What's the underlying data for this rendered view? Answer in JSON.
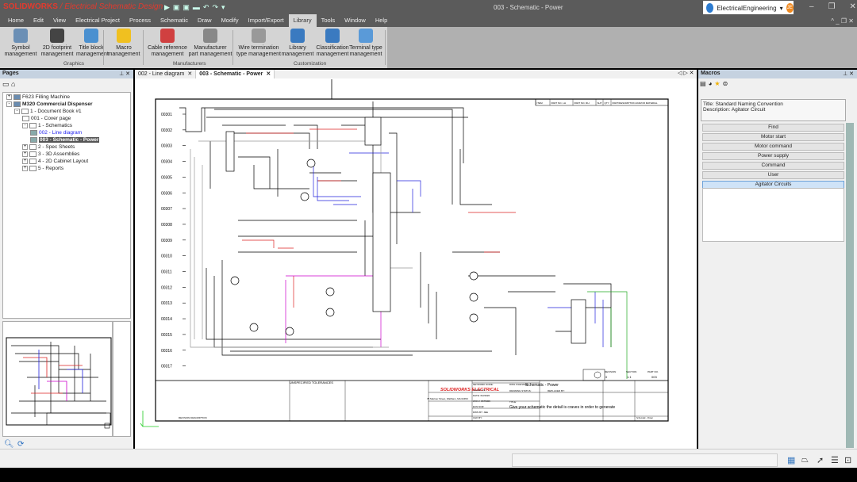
{
  "app": {
    "brand": "SOLIDWORKS",
    "product": "Electrical Schematic Design",
    "window_title": "003 - Schematic - Power",
    "account": "ElectricalEngineering",
    "user_initials": "JE",
    "accent": "#e23a2e"
  },
  "menu": [
    "Home",
    "Edit",
    "View",
    "Electrical Project",
    "Process",
    "Schematic",
    "Draw",
    "Modify",
    "Import/Export",
    "Library",
    "Tools",
    "Window",
    "Help"
  ],
  "active_menu": "Library",
  "ribbon": {
    "buttons": [
      {
        "l1": "Symbol",
        "l2": "management",
        "icon": "symbol-icon",
        "color": "#6b8fb5"
      },
      {
        "l1": "2D footprint",
        "l2": "management",
        "icon": "footprint-icon",
        "color": "#444"
      },
      {
        "l1": "Title block",
        "l2": "management",
        "icon": "title-block-icon",
        "color": "#4a90d0"
      },
      {
        "l1": "Macro",
        "l2": "management",
        "icon": "macro-star-icon",
        "color": "#f0c020"
      },
      {
        "l1": "Cable reference",
        "l2": "management",
        "icon": "cable-icon",
        "color": "#d04040"
      },
      {
        "l1": "Manufacturer",
        "l2": "part management",
        "icon": "wrench-icon",
        "color": "#888"
      },
      {
        "l1": "Wire termination",
        "l2": "type management",
        "icon": "terminal-lug-icon",
        "color": "#999"
      },
      {
        "l1": "Library",
        "l2": "management",
        "icon": "library-icon",
        "color": "#3a7ac0"
      },
      {
        "l1": "Classification",
        "l2": "management",
        "icon": "classification-icon",
        "color": "#3a7ac0"
      },
      {
        "l1": "Terminal type",
        "l2": "management",
        "icon": "terminal-icon",
        "color": "#5a9ad8"
      }
    ],
    "groups": [
      "Graphics",
      "Manufacturers",
      "Customization"
    ]
  },
  "pages": {
    "title": "Pages",
    "tree": [
      {
        "label": "F623 Filling Machine",
        "level": 0,
        "exp": "+"
      },
      {
        "label": "M320 Commercial Dispenser",
        "level": 0,
        "exp": "-",
        "bold": true
      },
      {
        "label": "1 - Document Book #1",
        "level": 1,
        "exp": "-"
      },
      {
        "label": "001 - Cover page",
        "level": 2
      },
      {
        "label": "1 - Schematics",
        "level": 2,
        "exp": "-"
      },
      {
        "label": "002 - Line diagram",
        "level": 3,
        "link": true
      },
      {
        "label": "003 - Schematic - Power",
        "level": 3,
        "selected": true
      },
      {
        "label": "2 - Spec Sheets",
        "level": 2,
        "exp": "+"
      },
      {
        "label": "3 - 3D Assemblies",
        "level": 2,
        "exp": "+"
      },
      {
        "label": "4 - 2D Cabinet Layout",
        "level": 2,
        "exp": "+"
      },
      {
        "label": "5 - Reports",
        "level": 2,
        "exp": "+"
      }
    ]
  },
  "doc_tabs": [
    {
      "label": "002 - Line diagram"
    },
    {
      "label": "003 - Schematic - Power",
      "active": true
    }
  ],
  "schematic": {
    "rows": [
      "00301",
      "00302",
      "00303",
      "00304",
      "00305",
      "00306",
      "00307",
      "00308",
      "00309",
      "00310",
      "00311",
      "00312",
      "00313",
      "00314",
      "00315",
      "00316",
      "00317"
    ],
    "bom_header": [
      "ITEM",
      "PART NO. LH",
      "PART NO. RH",
      "SHT",
      "QTY",
      "PART/DESCRIPTION AND/OR MATERIAL"
    ],
    "title_block": {
      "tolerances": "UNSPECIFIED TOLERANCES",
      "company": "SOLIDWORKS ELECTRICAL",
      "address": "75 Mariner Street, Waltham, MA 02453",
      "network_node": "NETWORK NODE:",
      "scale": "SCALE: 1/1",
      "date": "DATE: 6/2/2020",
      "wo": "W/O #: 8675309",
      "ecn": "ECN NO#:",
      "drawn_by": "DWN BY: JEE",
      "chk_by": "CHK BY:",
      "dwg_label": "DWG FILENAME:",
      "dwg_name": "Schematic - Power",
      "drawing_status": "DRAWING STATUS:",
      "replaced_by": "REPLACED BY:",
      "title_label": "TITLE:",
      "title": "Give your schematic the detail is craves in order to generate",
      "revision": "0",
      "sheet": "1.1",
      "part_no": "003",
      "col_labels": [
        "REVISION",
        "SECTION",
        "PART NO."
      ],
      "sheet_name": "Schematic - Power",
      "rev_desc_header": "REVISION DESCRIPTION"
    }
  },
  "macros": {
    "title": "Macros",
    "desc_title": "Title: Standard Naming Convention",
    "desc": "Description: Agitator Circuit",
    "items": [
      "Find",
      "Motor start",
      "Motor command",
      "Power supply",
      "Command",
      "User",
      "Agitator Circuits"
    ],
    "selected": "Agitator Circuits"
  }
}
